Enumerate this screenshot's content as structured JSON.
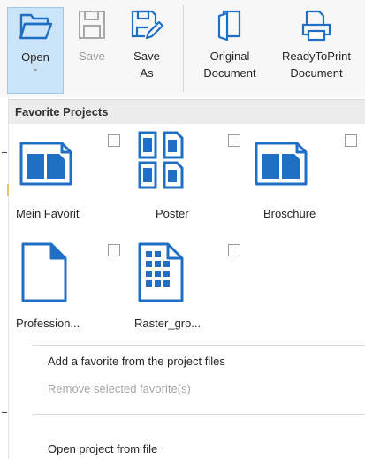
{
  "ribbon": {
    "open_label": "Open",
    "save_label": "Save",
    "save_as_label": "Save\nAs",
    "original_label": "Original\nDocument",
    "readytoprint_label": "ReadyToPrint\nDocument",
    "open_caret": "⌄"
  },
  "favorites": {
    "header": "Favorite Projects",
    "items": [
      {
        "label": "Mein Favorit",
        "icon": "two-page-layout-icon",
        "checked": false
      },
      {
        "label": "Poster",
        "icon": "four-sheet-layout-icon",
        "checked": false
      },
      {
        "label": "Broschüre",
        "icon": "two-page-layout-icon",
        "checked": false
      },
      {
        "label": "Profession...",
        "icon": "blank-page-icon",
        "checked": false
      },
      {
        "label": "Raster_gro...",
        "icon": "grid-page-icon",
        "checked": false
      }
    ]
  },
  "menu": {
    "add_favorite": "Add a favorite from the project files",
    "remove_favorite": "Remove selected favorite(s)",
    "open_from_file": "Open project from file"
  },
  "colors": {
    "accent": "#1f6fc5",
    "active_fill": "#cce4f7",
    "header_bg": "#ececec",
    "disabled_text": "#a6a6a6"
  }
}
